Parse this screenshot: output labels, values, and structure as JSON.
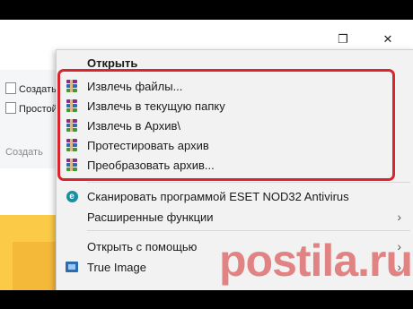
{
  "window": {
    "maximize_glyph": "❐",
    "close_glyph": "✕"
  },
  "ribbon": {
    "items": [
      "Создать э",
      "Простой д"
    ],
    "group_label": "Создать"
  },
  "context_menu": {
    "top_item": "Открыть",
    "archive_items": [
      {
        "label": "Извлечь файлы...",
        "icon": "winrar-icon"
      },
      {
        "label": "Извлечь в текущую папку",
        "icon": "winrar-icon"
      },
      {
        "label": "Извлечь в Архив\\",
        "icon": "winrar-icon"
      },
      {
        "label": "Протестировать архив",
        "icon": "winrar-icon"
      },
      {
        "label": "Преобразовать архив...",
        "icon": "winrar-icon"
      }
    ],
    "eset_item": {
      "label": "Сканировать программой ESET NOD32 Antivirus",
      "icon": "eset-icon"
    },
    "advanced_item": {
      "label": "Расширенные функции",
      "has_submenu": true
    },
    "open_with_item": {
      "label": "Открыть с помощью",
      "has_submenu": true
    },
    "true_image_item": {
      "label": "True Image",
      "icon": "true-image-icon",
      "has_submenu": true
    },
    "submenu_arrow": "›"
  },
  "colors": {
    "highlight_border": "#d9262e",
    "menu_background": "#f2f2f2"
  },
  "watermark": "postila.ru"
}
